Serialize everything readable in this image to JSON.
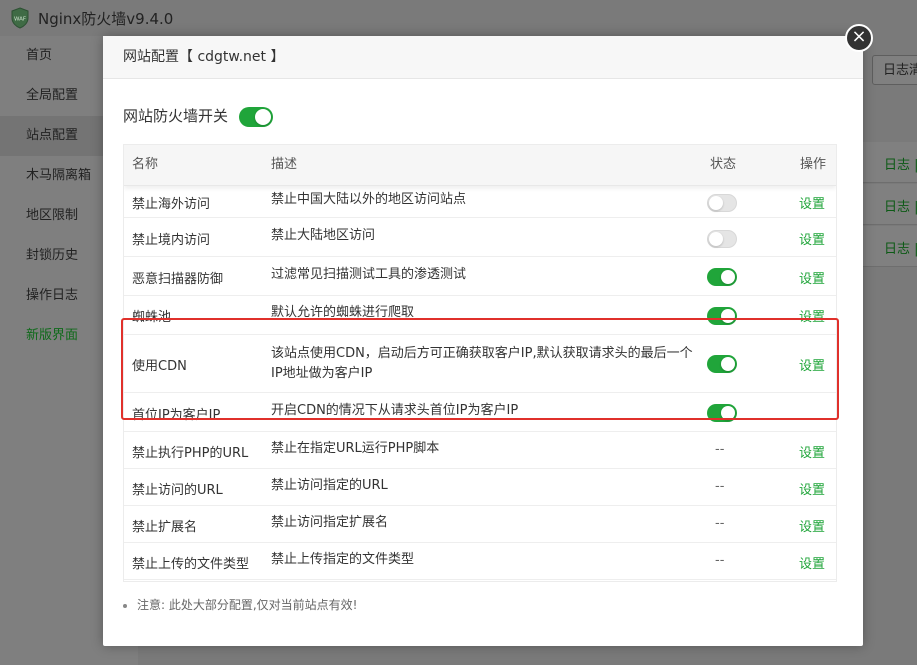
{
  "app": {
    "title": "Nginx防火墙v9.4.0"
  },
  "sidebar": {
    "items": [
      {
        "label": "首页"
      },
      {
        "label": "全局配置"
      },
      {
        "label": "站点配置"
      },
      {
        "label": "木马隔离箱"
      },
      {
        "label": "地区限制"
      },
      {
        "label": "封锁历史"
      },
      {
        "label": "操作日志"
      },
      {
        "label": "新版界面"
      }
    ]
  },
  "background": {
    "log_button": "日志清",
    "row_link": "日志 |"
  },
  "modal": {
    "title": "网站配置【 cdgtw.net 】",
    "close_symbol": "×",
    "switch_label": "网站防火墙开关",
    "switch_on": true,
    "columns": {
      "name": "名称",
      "desc": "描述",
      "status": "状态",
      "op": "操作"
    },
    "rows": [
      {
        "name": "禁止海外访问",
        "desc": "禁止中国大陆以外的地区访问站点",
        "status": "off",
        "op": "设置"
      },
      {
        "name": "禁止境内访问",
        "desc": "禁止大陆地区访问",
        "status": "off",
        "op": "设置"
      },
      {
        "name": "恶意扫描器防御",
        "desc": "过滤常见扫描测试工具的渗透测试",
        "status": "on",
        "op": "设置"
      },
      {
        "name": "蜘蛛池",
        "desc": "默认允许的蜘蛛进行爬取",
        "status": "on",
        "op": "设置"
      },
      {
        "name": "使用CDN",
        "desc": "该站点使用CDN，启动后方可正确获取客户IP,默认获取请求头的最后一个IP地址做为客户IP",
        "status": "on",
        "op": "设置"
      },
      {
        "name": "首位IP为客户IP",
        "desc": "开启CDN的情况下从请求头首位IP为客户IP",
        "status": "on",
        "op": ""
      },
      {
        "name": "禁止执行PHP的URL",
        "desc": "禁止在指定URL运行PHP脚本",
        "status": "--",
        "op": "设置"
      },
      {
        "name": "禁止访问的URL",
        "desc": "禁止访问指定的URL",
        "status": "--",
        "op": "设置"
      },
      {
        "name": "禁止扩展名",
        "desc": "禁止访问指定扩展名",
        "status": "--",
        "op": "设置"
      },
      {
        "name": "禁止上传的文件类型",
        "desc": "禁止上传指定的文件类型",
        "status": "--",
        "op": "设置"
      }
    ],
    "note": "注意: 此处大部分配置,仅对当前站点有效!"
  },
  "colors": {
    "accent_green": "#20a53a",
    "highlight_red": "#e0302b"
  }
}
